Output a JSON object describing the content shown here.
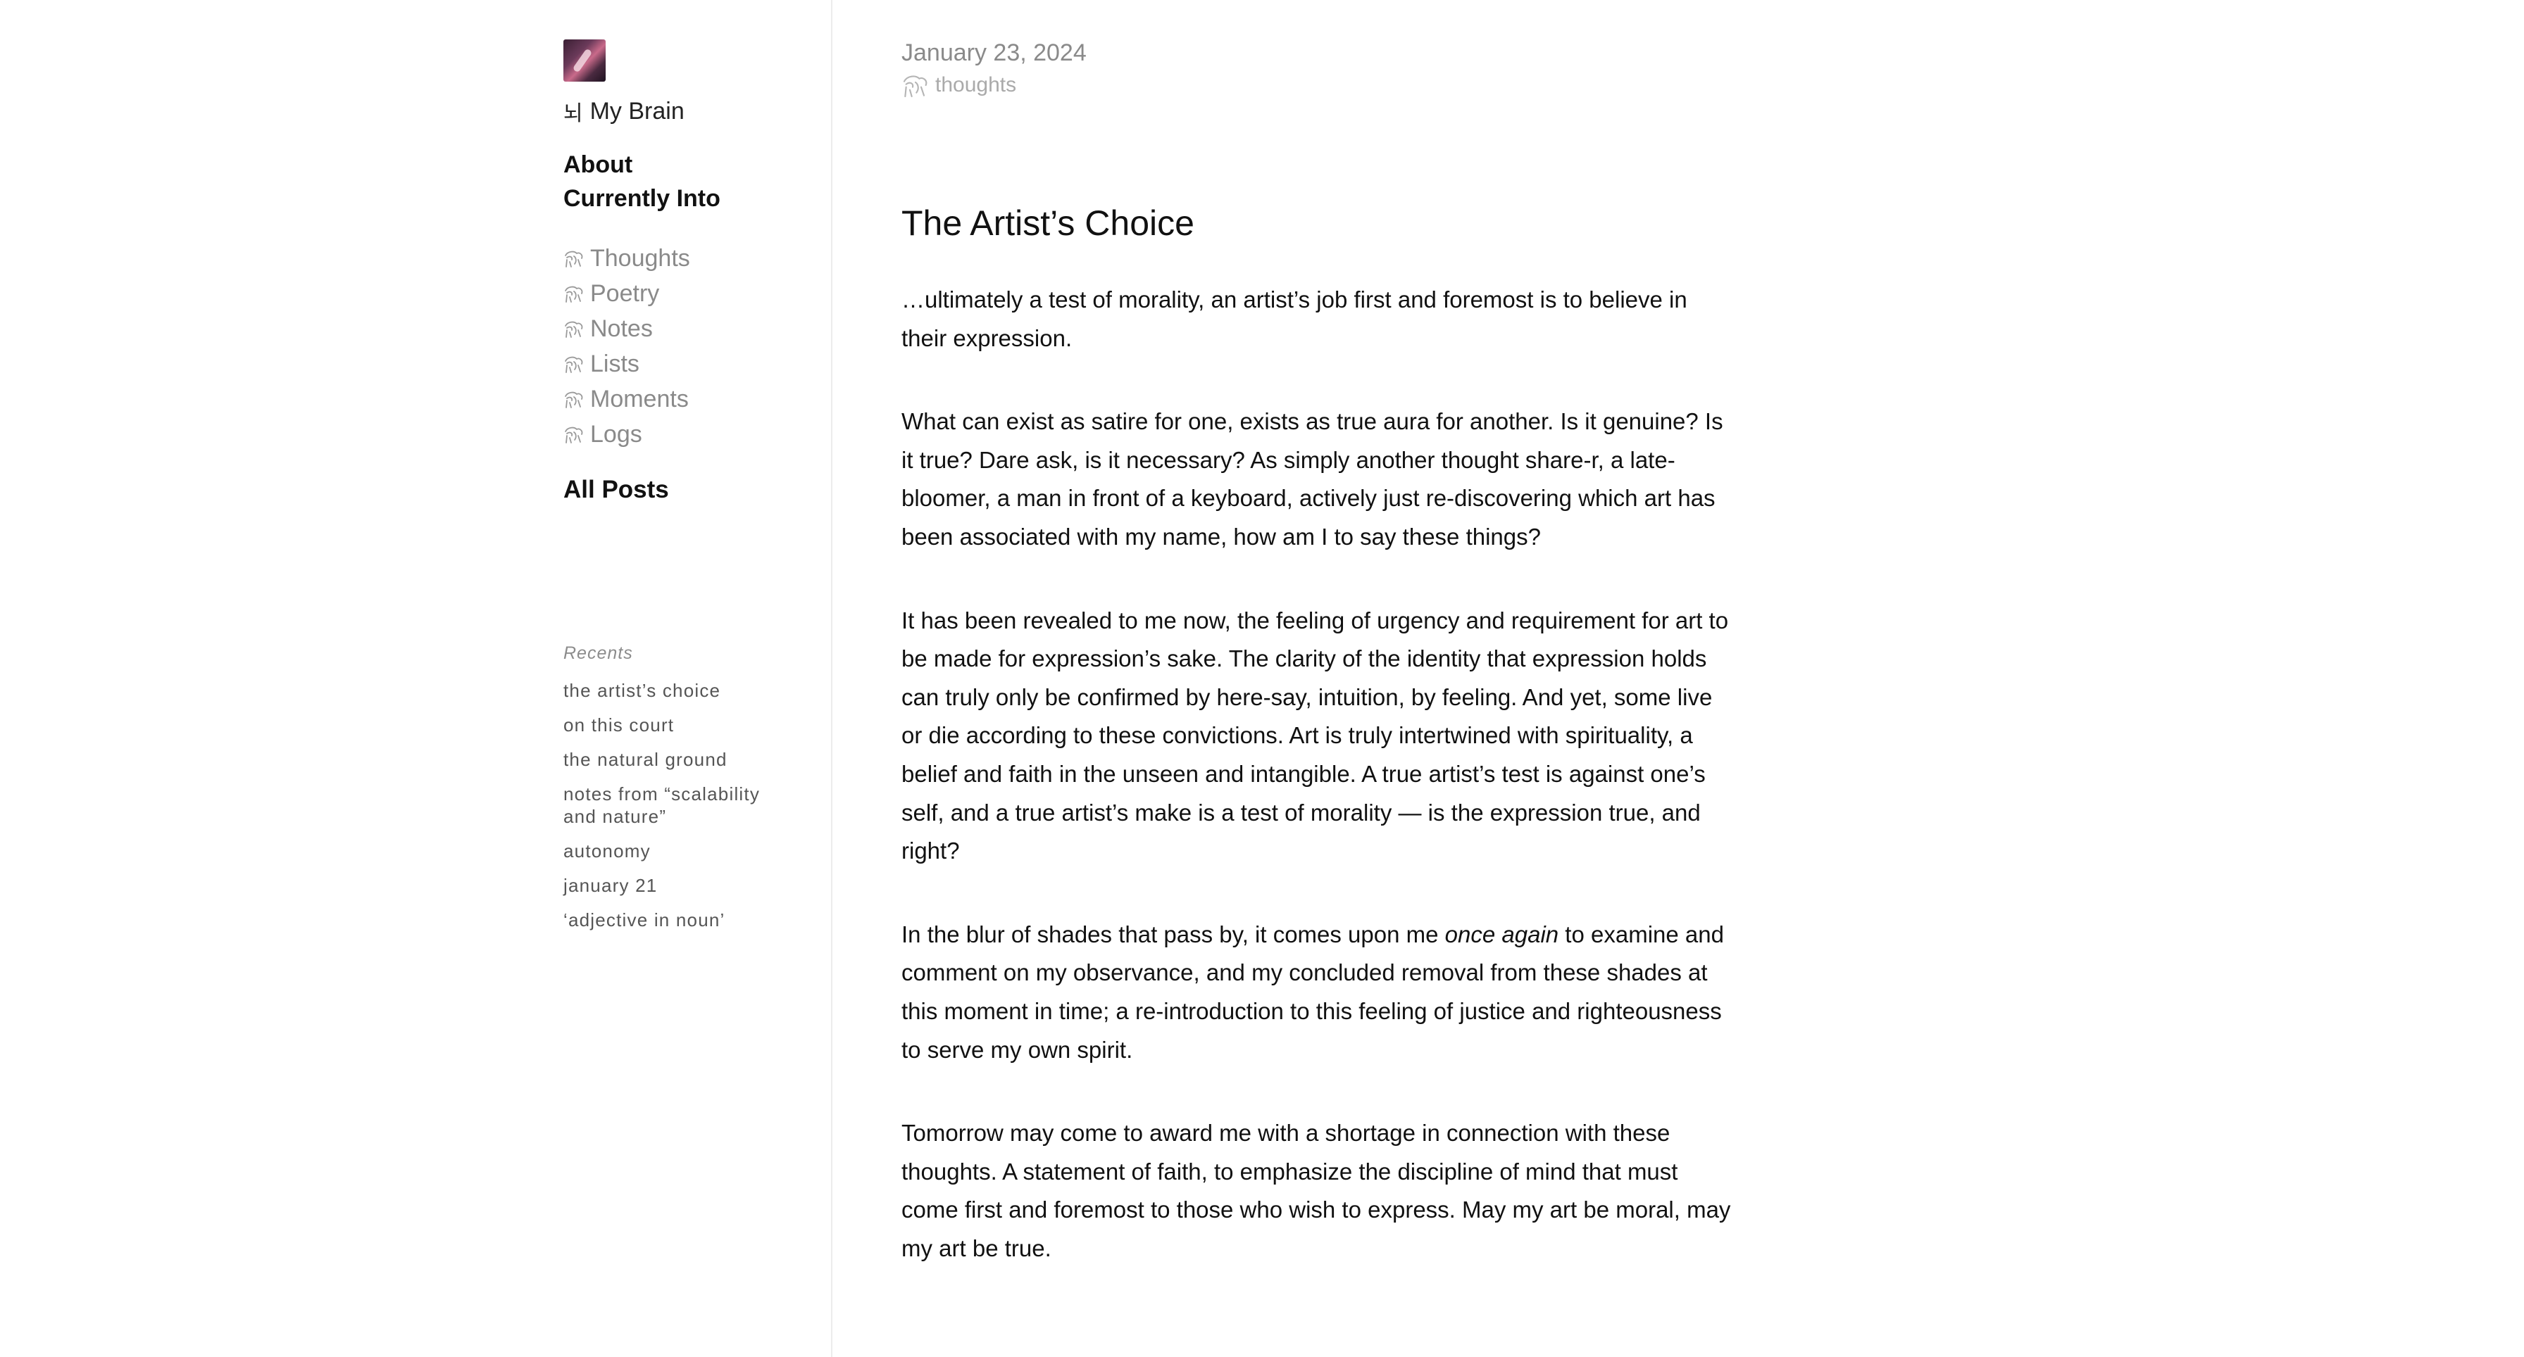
{
  "sidebar": {
    "brand": {
      "glyph": "뇌",
      "label": "My Brain"
    },
    "main_nav": [
      {
        "label": "About"
      },
      {
        "label": "Currently Into"
      }
    ],
    "categories": [
      {
        "label": "Thoughts",
        "icon": "brain-doodle-icon"
      },
      {
        "label": "Poetry",
        "icon": "brain-doodle-icon"
      },
      {
        "label": "Notes",
        "icon": "brain-doodle-icon"
      },
      {
        "label": "Lists",
        "icon": "brain-doodle-icon"
      },
      {
        "label": "Moments",
        "icon": "brain-doodle-icon"
      },
      {
        "label": "Logs",
        "icon": "brain-doodle-icon"
      }
    ],
    "all_posts": "All Posts",
    "recents": {
      "title": "Recents",
      "items": [
        "the artist’s choice",
        "on this court",
        "the natural ground",
        "notes from “scalability and nature”",
        "autonomy",
        "january 21",
        "‘adjective in noun’"
      ]
    }
  },
  "post": {
    "date": "January 23, 2024",
    "tag": {
      "label": "thoughts",
      "icon": "brain-doodle-icon"
    },
    "title": "The Artist’s Choice",
    "paragraphs": [
      {
        "text": "…ultimately a test of morality, an artist’s job first and foremost is to believe in their expression."
      },
      {
        "text": "What can exist as satire for one, exists as true aura for another. Is it genuine? Is it true? Dare ask, is it necessary? As simply another thought share-r, a late-bloomer, a man in front of a keyboard, actively just re-discovering which art has been associated with my name, how am I to say these things?"
      },
      {
        "text": "It has been revealed to me now, the feeling of urgency and requirement for art to be made for expression’s sake. The clarity of the identity that expression holds can truly only be confirmed by here-say, intuition, by feeling. And yet, some live or die according to these convictions. Art is truly intertwined with spirituality, a belief and faith in the unseen and intangible. A true artist’s test is against one’s self, and a true artist’s make is a test of morality — is the expression true, and right?"
      },
      {
        "before": "In the blur of shades that pass by, it comes upon me ",
        "emphasis": "once again",
        "after": " to examine and comment on my observance, and my concluded removal from these shades at this moment in time; a re-introduction to this feeling of justice and righteousness to serve my own spirit."
      },
      {
        "text": "Tomorrow may come to award me with a shortage in connection with these thoughts. A statement of faith, to emphasize the discipline of mind that must come first and foremost to those who wish to express. May my art be moral, may my art be true."
      }
    ]
  }
}
